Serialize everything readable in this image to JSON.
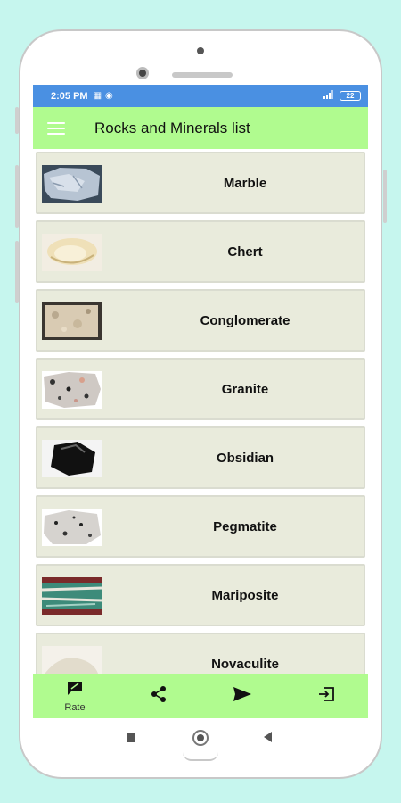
{
  "status_bar": {
    "time": "2:05 PM",
    "battery": "22"
  },
  "app_bar": {
    "title": "Rocks and Minerals list"
  },
  "items": [
    {
      "label": "Marble"
    },
    {
      "label": "Chert"
    },
    {
      "label": "Conglomerate"
    },
    {
      "label": "Granite"
    },
    {
      "label": "Obsidian"
    },
    {
      "label": "Pegmatite"
    },
    {
      "label": "Mariposite"
    },
    {
      "label": "Novaculite"
    }
  ],
  "bottom_bar": {
    "rate_label": "Rate",
    "icons": [
      "rate-icon",
      "share-icon",
      "send-icon",
      "exit-icon"
    ]
  },
  "colors": {
    "background": "#c6f6ee",
    "status_bar": "#4a90e2",
    "app_bar": "#b0fb8f",
    "list_item": "#e9ebdc"
  }
}
